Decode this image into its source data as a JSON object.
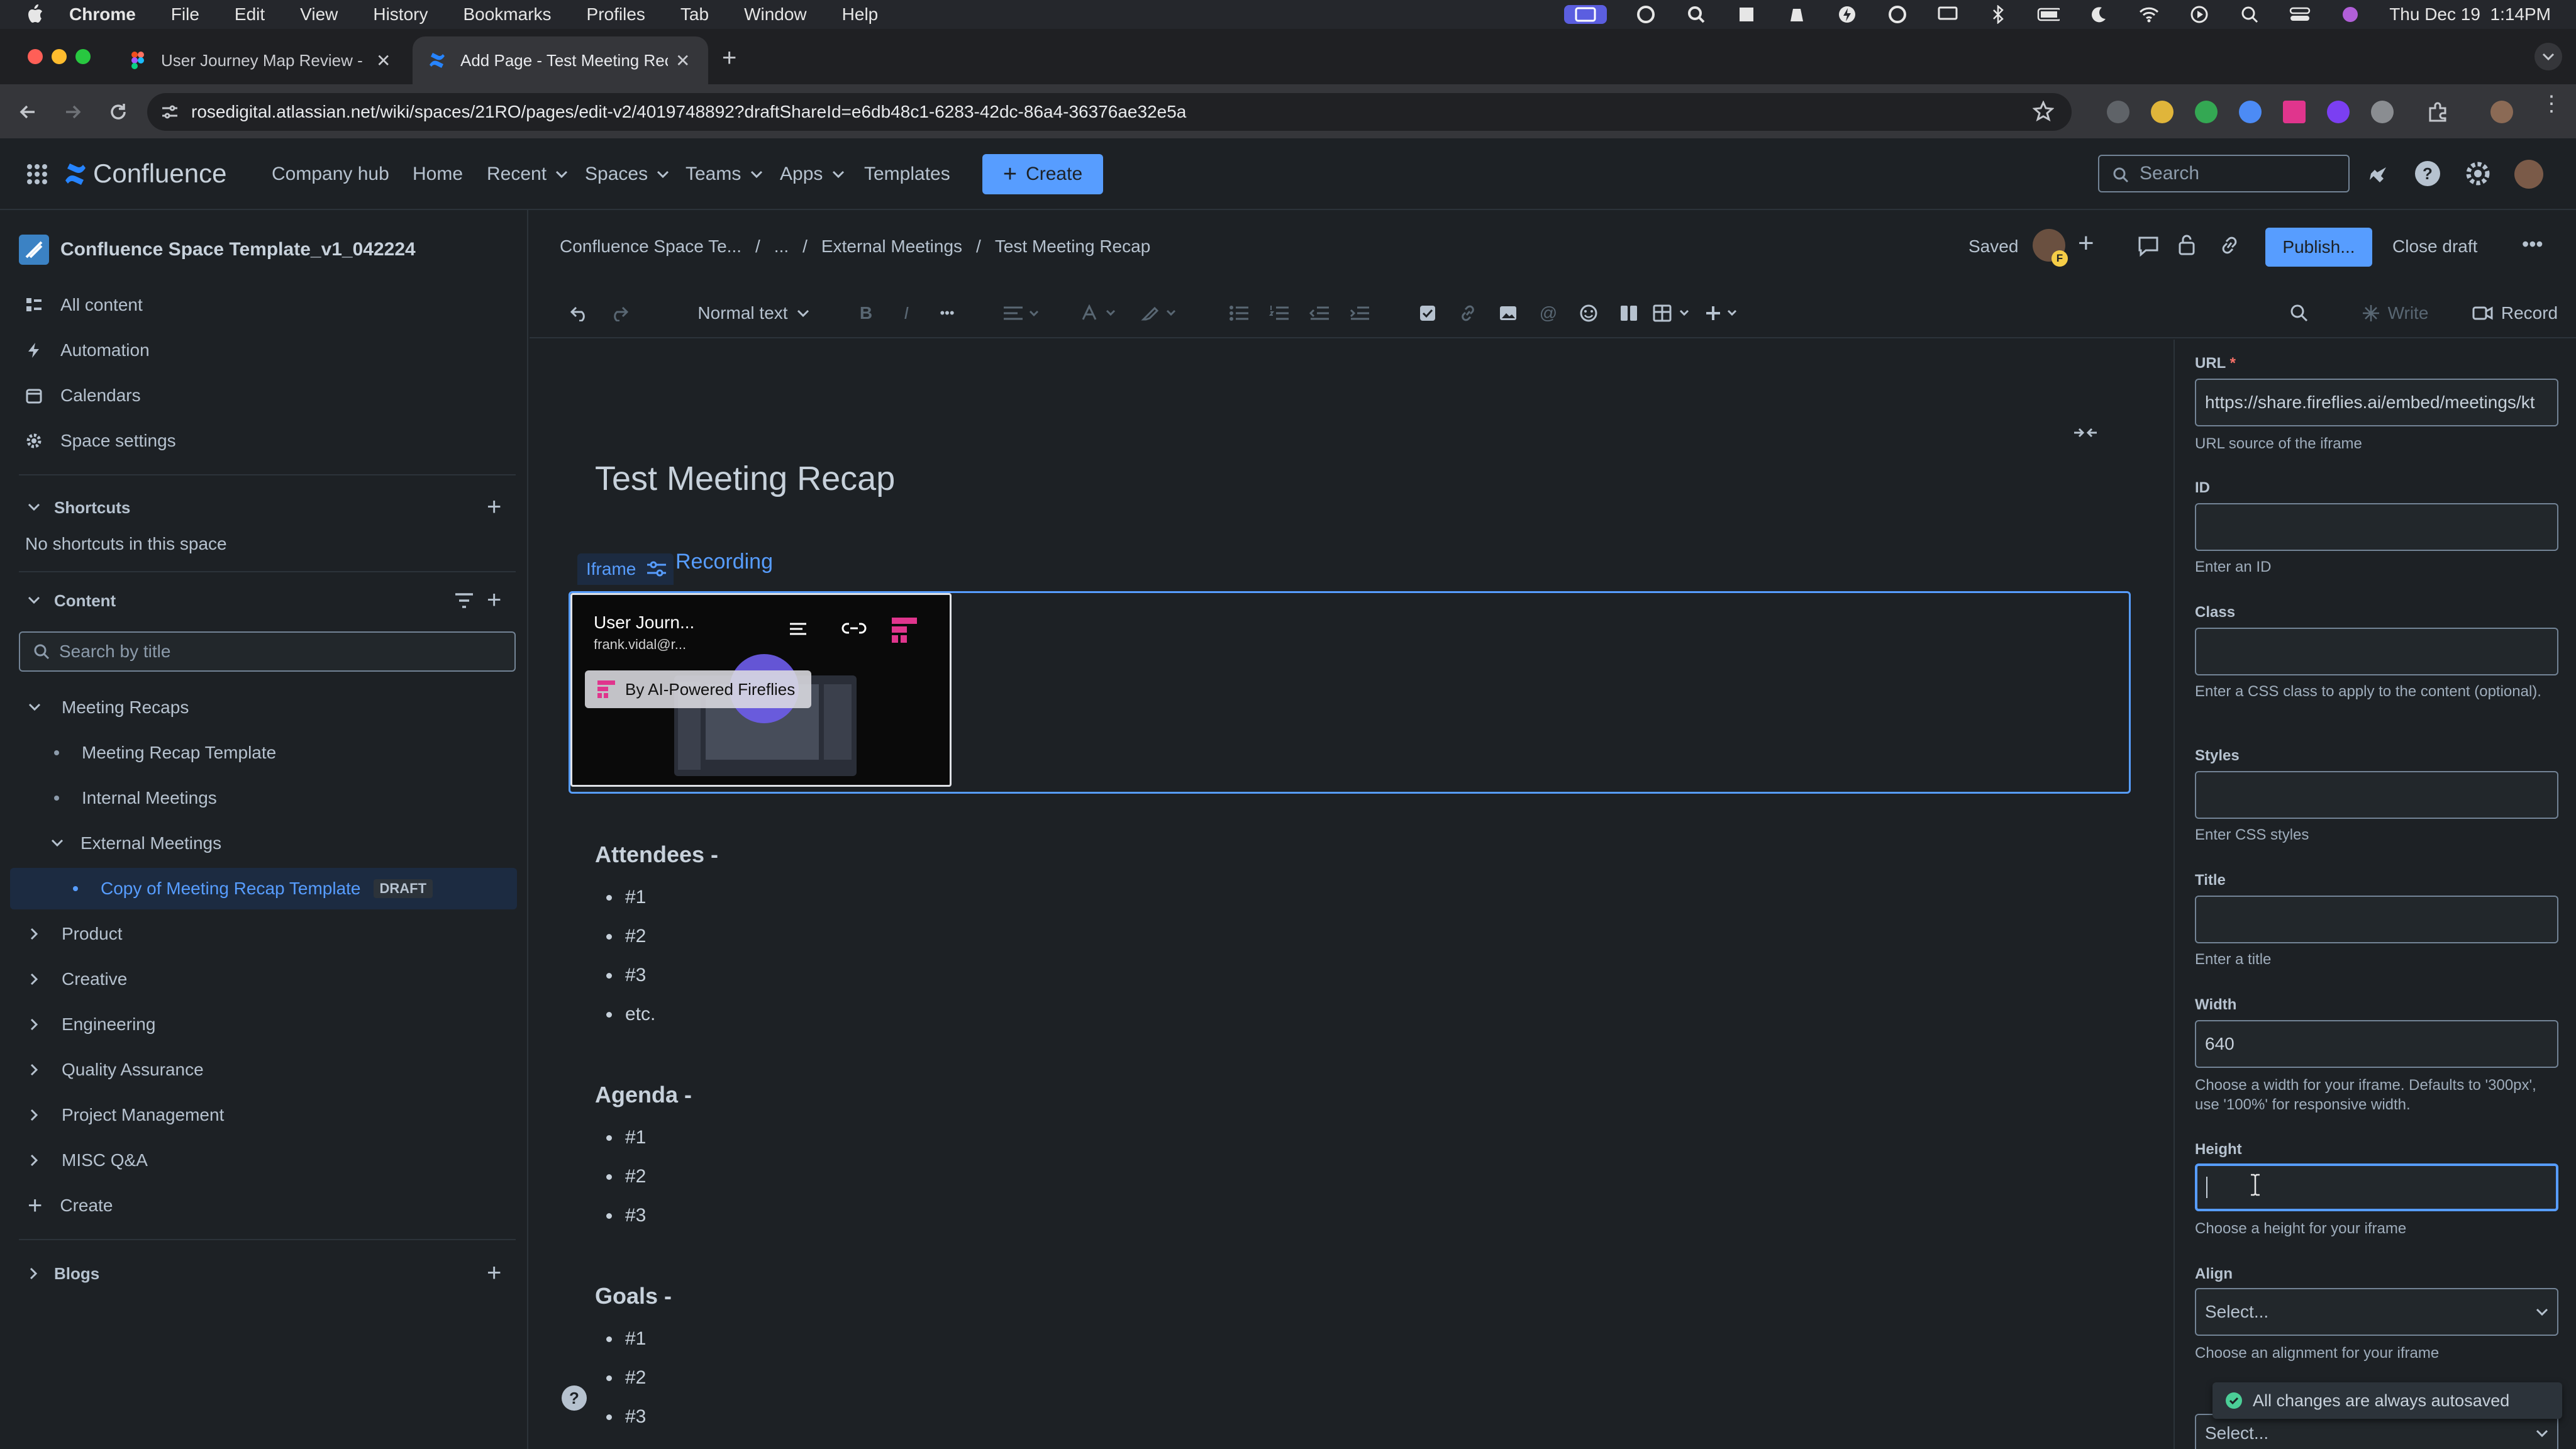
{
  "menubar": {
    "items": [
      "Chrome",
      "File",
      "Edit",
      "View",
      "History",
      "Bookmarks",
      "Profiles",
      "Tab",
      "Window",
      "Help"
    ],
    "datetime": "Thu Dec 19  1:14PM"
  },
  "browser": {
    "tabs": [
      {
        "title": "User Journey Map Review - M",
        "active": false
      },
      {
        "title": "Add Page - Test Meeting Rec",
        "active": true
      }
    ],
    "url": "rosedigital.atlassian.net/wiki/spaces/21RO/pages/edit-v2/4019748892?draftShareId=e6db48c1-6283-42dc-86a4-36376ae32e5a"
  },
  "topnav": {
    "product": "Confluence",
    "items": [
      "Company hub",
      "Home",
      "Recent",
      "Spaces",
      "Teams",
      "Apps",
      "Templates"
    ],
    "create_label": "Create",
    "search_placeholder": "Search"
  },
  "sidebar": {
    "space_name": "Confluence Space Template_v1_042224",
    "nav": [
      "All content",
      "Automation",
      "Calendars",
      "Space settings"
    ],
    "shortcuts_heading": "Shortcuts",
    "shortcuts_empty": "No shortcuts in this space",
    "content_heading": "Content",
    "search_placeholder": "Search by title",
    "tree": {
      "meeting_recaps": "Meeting Recaps",
      "meeting_recap_template": "Meeting Recap Template",
      "internal_meetings": "Internal Meetings",
      "external_meetings": "External Meetings",
      "copy_template": "Copy of Meeting Recap Template",
      "draft_badge": "DRAFT",
      "product": "Product",
      "creative": "Creative",
      "engineering": "Engineering",
      "qa": "Quality Assurance",
      "pm": "Project Management",
      "misc": "MISC Q&A",
      "create": "Create"
    },
    "blogs_heading": "Blogs"
  },
  "editor_header": {
    "breadcrumb": [
      "Confluence Space Te...",
      "...",
      "External Meetings",
      "Test Meeting Recap"
    ],
    "saved_label": "Saved",
    "publish_label": "Publish...",
    "close_draft_label": "Close draft",
    "avatar_badge": "F"
  },
  "toolbar": {
    "text_style": "Normal text",
    "write_label": "Write",
    "record_label": "Record"
  },
  "document": {
    "title": "Test Meeting Recap",
    "iframe_label": "Iframe",
    "recording_heading": "Recording",
    "embed": {
      "title": "User Journ...",
      "subtitle": "frank.vidal@r...",
      "brand": "By AI-Powered Fireflies"
    },
    "sections": [
      {
        "heading": "Attendees -",
        "items": [
          "#1",
          "#2",
          "#3",
          "etc."
        ]
      },
      {
        "heading": "Agenda -",
        "items": [
          "#1",
          "#2",
          "#3"
        ]
      },
      {
        "heading": "Goals -",
        "items": [
          "#1",
          "#2",
          "#3"
        ]
      }
    ]
  },
  "panel": {
    "url_label": "URL",
    "url_value": "https://share.fireflies.ai/embed/meetings/kt",
    "url_help": "URL source of the iframe",
    "id_label": "ID",
    "id_help": "Enter an ID",
    "class_label": "Class",
    "class_help": "Enter a CSS class to apply to the content (optional).",
    "styles_label": "Styles",
    "styles_help": "Enter CSS styles",
    "title_label": "Title",
    "title_help": "Enter a title",
    "width_label": "Width",
    "width_value": "640",
    "width_help": "Choose a width for your iframe. Defaults to '300px', use '100%' for responsive width.",
    "height_label": "Height",
    "height_help": "Choose a height for your iframe",
    "align_label": "Align",
    "align_placeholder": "Select...",
    "align_help": "Choose an alignment for your iframe",
    "next_select_placeholder": "Select...",
    "toast": "All changes are always autosaved"
  },
  "colors": {
    "accent": "#579dff",
    "background": "#1d2125",
    "fireflies": "#e0358d"
  }
}
